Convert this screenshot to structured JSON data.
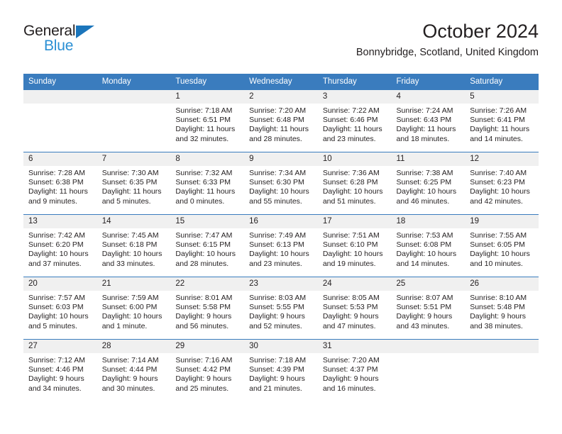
{
  "brand": {
    "name_part1": "General",
    "name_part2": "Blue",
    "triangle_color": "#1b75bb",
    "blue_text_color": "#2a8fd4"
  },
  "header": {
    "title": "October 2024",
    "subtitle": "Bonnybridge, Scotland, United Kingdom"
  },
  "theme": {
    "header_blue": "#3a7cbe",
    "daynum_background": "#f0f0f0",
    "text_color": "#231f20"
  },
  "weekdays": [
    "Sunday",
    "Monday",
    "Tuesday",
    "Wednesday",
    "Thursday",
    "Friday",
    "Saturday"
  ],
  "labels": {
    "sunrise_prefix": "Sunrise:",
    "sunset_prefix": "Sunset:",
    "daylight_prefix": "Daylight:"
  },
  "weeks": [
    [
      {
        "day": ""
      },
      {
        "day": ""
      },
      {
        "day": "1",
        "sunrise": "Sunrise: 7:18 AM",
        "sunset": "Sunset: 6:51 PM",
        "daylight": "Daylight: 11 hours and 32 minutes."
      },
      {
        "day": "2",
        "sunrise": "Sunrise: 7:20 AM",
        "sunset": "Sunset: 6:48 PM",
        "daylight": "Daylight: 11 hours and 28 minutes."
      },
      {
        "day": "3",
        "sunrise": "Sunrise: 7:22 AM",
        "sunset": "Sunset: 6:46 PM",
        "daylight": "Daylight: 11 hours and 23 minutes."
      },
      {
        "day": "4",
        "sunrise": "Sunrise: 7:24 AM",
        "sunset": "Sunset: 6:43 PM",
        "daylight": "Daylight: 11 hours and 18 minutes."
      },
      {
        "day": "5",
        "sunrise": "Sunrise: 7:26 AM",
        "sunset": "Sunset: 6:41 PM",
        "daylight": "Daylight: 11 hours and 14 minutes."
      }
    ],
    [
      {
        "day": "6",
        "sunrise": "Sunrise: 7:28 AM",
        "sunset": "Sunset: 6:38 PM",
        "daylight": "Daylight: 11 hours and 9 minutes."
      },
      {
        "day": "7",
        "sunrise": "Sunrise: 7:30 AM",
        "sunset": "Sunset: 6:35 PM",
        "daylight": "Daylight: 11 hours and 5 minutes."
      },
      {
        "day": "8",
        "sunrise": "Sunrise: 7:32 AM",
        "sunset": "Sunset: 6:33 PM",
        "daylight": "Daylight: 11 hours and 0 minutes."
      },
      {
        "day": "9",
        "sunrise": "Sunrise: 7:34 AM",
        "sunset": "Sunset: 6:30 PM",
        "daylight": "Daylight: 10 hours and 55 minutes."
      },
      {
        "day": "10",
        "sunrise": "Sunrise: 7:36 AM",
        "sunset": "Sunset: 6:28 PM",
        "daylight": "Daylight: 10 hours and 51 minutes."
      },
      {
        "day": "11",
        "sunrise": "Sunrise: 7:38 AM",
        "sunset": "Sunset: 6:25 PM",
        "daylight": "Daylight: 10 hours and 46 minutes."
      },
      {
        "day": "12",
        "sunrise": "Sunrise: 7:40 AM",
        "sunset": "Sunset: 6:23 PM",
        "daylight": "Daylight: 10 hours and 42 minutes."
      }
    ],
    [
      {
        "day": "13",
        "sunrise": "Sunrise: 7:42 AM",
        "sunset": "Sunset: 6:20 PM",
        "daylight": "Daylight: 10 hours and 37 minutes."
      },
      {
        "day": "14",
        "sunrise": "Sunrise: 7:45 AM",
        "sunset": "Sunset: 6:18 PM",
        "daylight": "Daylight: 10 hours and 33 minutes."
      },
      {
        "day": "15",
        "sunrise": "Sunrise: 7:47 AM",
        "sunset": "Sunset: 6:15 PM",
        "daylight": "Daylight: 10 hours and 28 minutes."
      },
      {
        "day": "16",
        "sunrise": "Sunrise: 7:49 AM",
        "sunset": "Sunset: 6:13 PM",
        "daylight": "Daylight: 10 hours and 23 minutes."
      },
      {
        "day": "17",
        "sunrise": "Sunrise: 7:51 AM",
        "sunset": "Sunset: 6:10 PM",
        "daylight": "Daylight: 10 hours and 19 minutes."
      },
      {
        "day": "18",
        "sunrise": "Sunrise: 7:53 AM",
        "sunset": "Sunset: 6:08 PM",
        "daylight": "Daylight: 10 hours and 14 minutes."
      },
      {
        "day": "19",
        "sunrise": "Sunrise: 7:55 AM",
        "sunset": "Sunset: 6:05 PM",
        "daylight": "Daylight: 10 hours and 10 minutes."
      }
    ],
    [
      {
        "day": "20",
        "sunrise": "Sunrise: 7:57 AM",
        "sunset": "Sunset: 6:03 PM",
        "daylight": "Daylight: 10 hours and 5 minutes."
      },
      {
        "day": "21",
        "sunrise": "Sunrise: 7:59 AM",
        "sunset": "Sunset: 6:00 PM",
        "daylight": "Daylight: 10 hours and 1 minute."
      },
      {
        "day": "22",
        "sunrise": "Sunrise: 8:01 AM",
        "sunset": "Sunset: 5:58 PM",
        "daylight": "Daylight: 9 hours and 56 minutes."
      },
      {
        "day": "23",
        "sunrise": "Sunrise: 8:03 AM",
        "sunset": "Sunset: 5:55 PM",
        "daylight": "Daylight: 9 hours and 52 minutes."
      },
      {
        "day": "24",
        "sunrise": "Sunrise: 8:05 AM",
        "sunset": "Sunset: 5:53 PM",
        "daylight": "Daylight: 9 hours and 47 minutes."
      },
      {
        "day": "25",
        "sunrise": "Sunrise: 8:07 AM",
        "sunset": "Sunset: 5:51 PM",
        "daylight": "Daylight: 9 hours and 43 minutes."
      },
      {
        "day": "26",
        "sunrise": "Sunrise: 8:10 AM",
        "sunset": "Sunset: 5:48 PM",
        "daylight": "Daylight: 9 hours and 38 minutes."
      }
    ],
    [
      {
        "day": "27",
        "sunrise": "Sunrise: 7:12 AM",
        "sunset": "Sunset: 4:46 PM",
        "daylight": "Daylight: 9 hours and 34 minutes."
      },
      {
        "day": "28",
        "sunrise": "Sunrise: 7:14 AM",
        "sunset": "Sunset: 4:44 PM",
        "daylight": "Daylight: 9 hours and 30 minutes."
      },
      {
        "day": "29",
        "sunrise": "Sunrise: 7:16 AM",
        "sunset": "Sunset: 4:42 PM",
        "daylight": "Daylight: 9 hours and 25 minutes."
      },
      {
        "day": "30",
        "sunrise": "Sunrise: 7:18 AM",
        "sunset": "Sunset: 4:39 PM",
        "daylight": "Daylight: 9 hours and 21 minutes."
      },
      {
        "day": "31",
        "sunrise": "Sunrise: 7:20 AM",
        "sunset": "Sunset: 4:37 PM",
        "daylight": "Daylight: 9 hours and 16 minutes."
      },
      {
        "day": ""
      },
      {
        "day": ""
      }
    ]
  ]
}
